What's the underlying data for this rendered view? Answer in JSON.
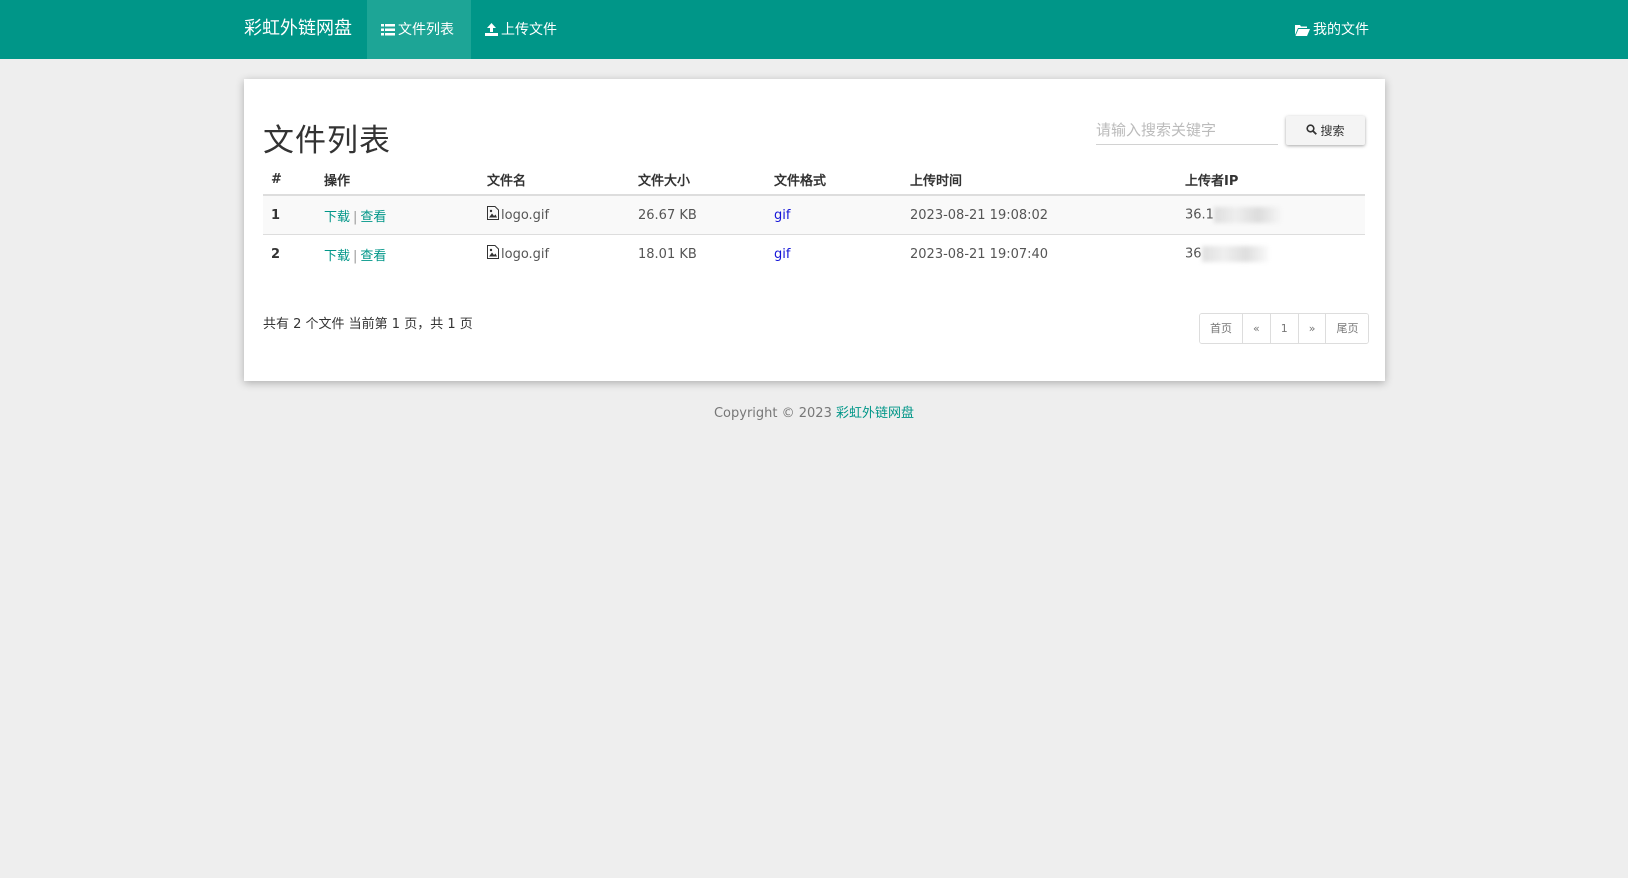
{
  "header": {
    "brand": "彩虹外链网盘",
    "nav": [
      {
        "label": "文件列表",
        "icon": "list-icon",
        "active": true
      },
      {
        "label": "上传文件",
        "icon": "upload-icon",
        "active": false
      }
    ],
    "right_nav": {
      "label": "我的文件",
      "icon": "folder-open-icon"
    }
  },
  "main": {
    "title": "文件列表",
    "search": {
      "placeholder": "请输入搜索关键字",
      "button_label": "搜索",
      "button_icon": "search-icon"
    },
    "table": {
      "columns": [
        "#",
        "操作",
        "文件名",
        "文件大小",
        "文件格式",
        "上传时间",
        "上传者IP"
      ],
      "rows": [
        {
          "index": "1",
          "action_download": "下载",
          "action_sep": "|",
          "action_view": "查看",
          "file_icon": "image-file-icon",
          "filename": "logo.gif",
          "size": "26.67 KB",
          "format": "gif",
          "time": "2023-08-21 19:08:02",
          "ip": "36.1"
        },
        {
          "index": "2",
          "action_download": "下载",
          "action_sep": "|",
          "action_view": "查看",
          "file_icon": "image-file-icon",
          "filename": "logo.gif",
          "size": "18.01 KB",
          "format": "gif",
          "time": "2023-08-21 19:07:40",
          "ip": "36"
        }
      ]
    },
    "summary": "共有 2 个文件  当前第 1 页，共 1 页",
    "pagination": {
      "first": "首页",
      "prev": "«",
      "current": "1",
      "next": "»",
      "last": "尾页"
    }
  },
  "footer": {
    "prefix": "Copyright © 2023 ",
    "link": "彩虹外链网盘"
  },
  "colors": {
    "primary": "#009688",
    "nav_active": "#1da596",
    "link_blue": "#1515d8",
    "background": "#eeeeee"
  }
}
